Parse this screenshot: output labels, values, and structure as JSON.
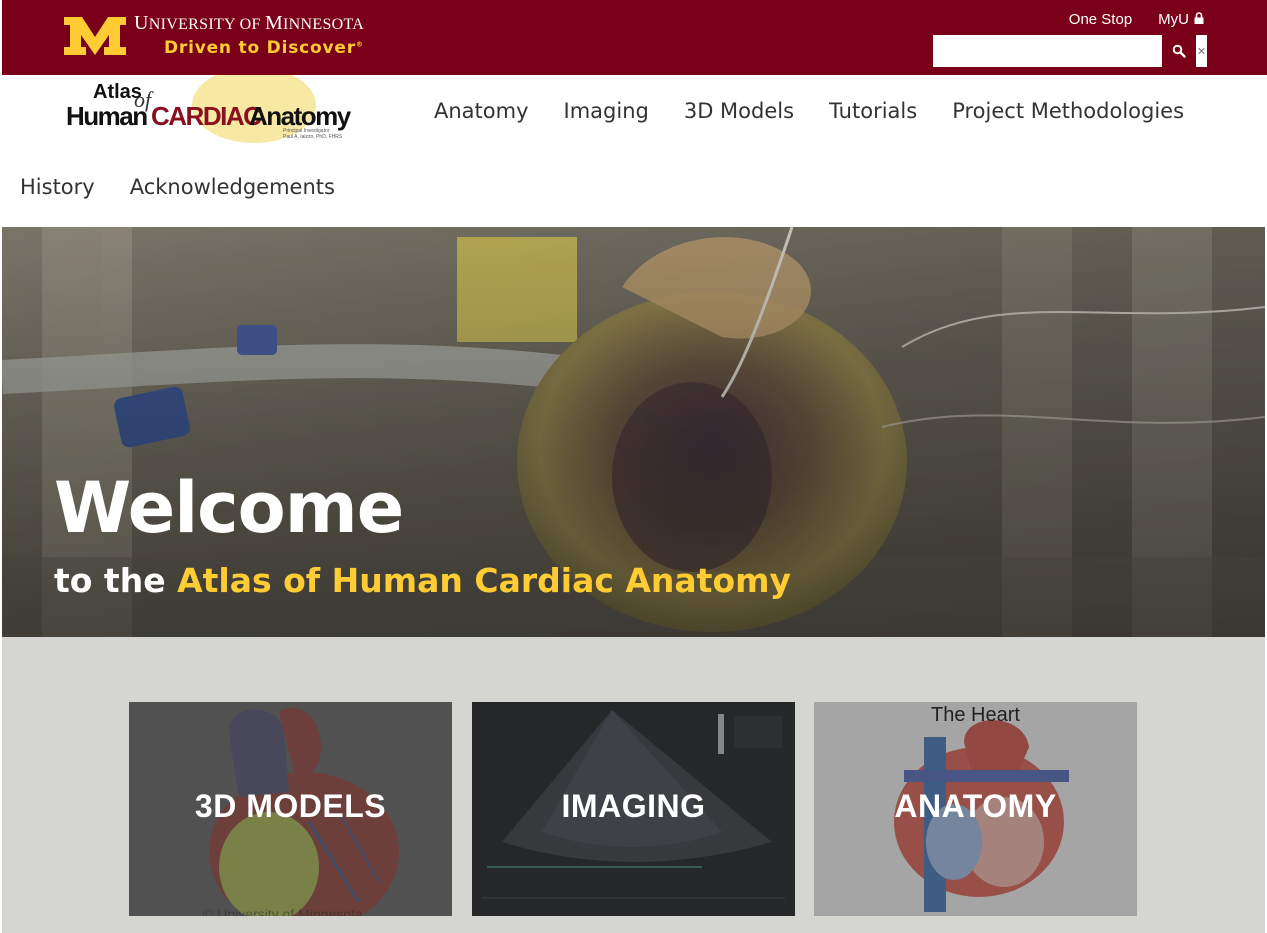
{
  "header": {
    "university_name_first": "U",
    "university_name_rest": "NIVERSITY OF ",
    "university_name_m": "M",
    "university_name_rest2": "INNESOTA",
    "tagline": "Driven to Discover",
    "tagline_mark": "®",
    "links": [
      {
        "label": "One Stop"
      },
      {
        "label": "MyU"
      }
    ],
    "search": {
      "value": "",
      "placeholder": ""
    }
  },
  "site": {
    "logo_line1": "Atlas",
    "logo_of": "of",
    "logo_human": "Human",
    "logo_cardiac": "CARDIAC",
    "logo_anatomy": "Anatomy",
    "logo_pi": "Principal Investigator",
    "logo_pi_name": "Paul A. Iaizzo, PhD, FHRS"
  },
  "nav": {
    "row1": [
      "Anatomy",
      "Imaging",
      "3D Models",
      "Tutorials",
      "Project Methodologies"
    ],
    "row2": [
      "History",
      "Acknowledgements"
    ]
  },
  "hero": {
    "title": "Welcome",
    "sub_prefix": "to the ",
    "sub_highlight": "Atlas of Human Cardiac Anatomy"
  },
  "tiles": [
    {
      "label": "3D MODELS",
      "footer": "© University of Minnesota"
    },
    {
      "label": "IMAGING"
    },
    {
      "label": "ANATOMY",
      "heading": "The Heart"
    }
  ],
  "colors": {
    "maroon": "#7a0019",
    "gold": "#ffcc33"
  }
}
